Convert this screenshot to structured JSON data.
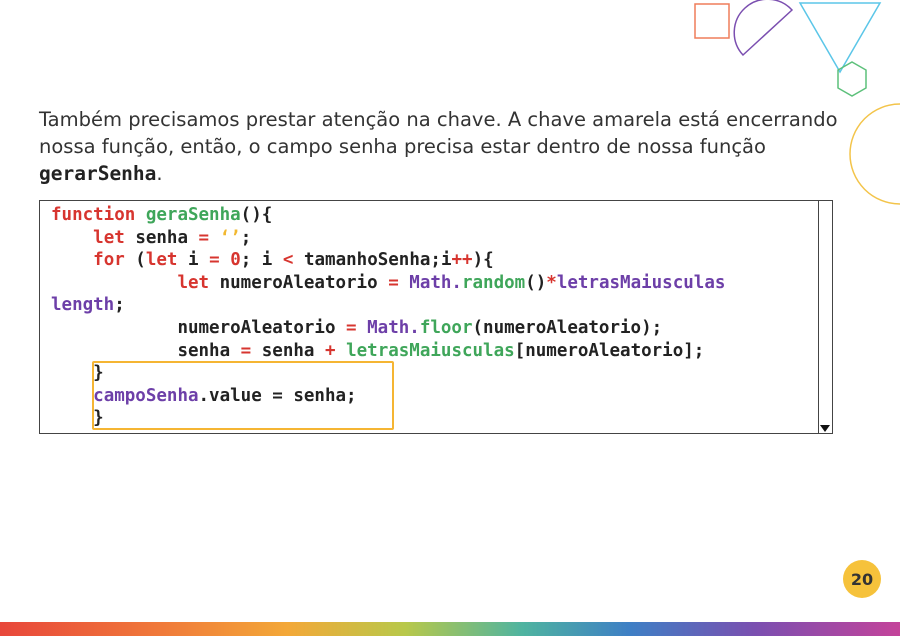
{
  "paragraph": {
    "text_before": "Também precisamos prestar atenção na chave. A chave amarela está encerrando nossa função, então, o campo senha precisa estar dentro de nossa função ",
    "code_term": "gerarSenha",
    "text_after": "."
  },
  "code": {
    "line1_kw": "function",
    "line1_fn": "geraSenha",
    "line1_rest": "(){",
    "line2_kw": "let",
    "line2_var": "senha",
    "line2_op": "=",
    "line2_str": "‘’",
    "line2_end": ";",
    "line3_for": "for",
    "line3_let": "let",
    "line3_i": "i",
    "line3_eq": "=",
    "line3_zero": "0",
    "line3_mid": "; i",
    "line3_lt": "<",
    "line3_tam": "tamanhoSenha;i",
    "line3_inc": "++",
    "line3_end": "){",
    "line4_kw": "let",
    "line4_var": "numeroAleatorio",
    "line4_eq": "=",
    "line4_math": "Math.",
    "line4_random": "random",
    "line4_paren": "()",
    "line4_star": "*",
    "line4_letras": "letrasMaiusculas",
    "line5_length": "length",
    "line5_end": ";",
    "line6_var": "numeroAleatorio",
    "line6_eq": "=",
    "line6_math": "Math.",
    "line6_floor": "floor",
    "line6_rest": "(numeroAleatorio);",
    "line7_senha": "senha",
    "line7_eq": "=",
    "line7_senha2": "senha",
    "line7_plus": "+",
    "line7_letras": "letrasMaiusculas",
    "line7_rest": "[numeroAleatorio];",
    "line8_brace": "}",
    "line9_campo": "campoSenha",
    "line9_rest": ".value = senha;",
    "line10_brace": "}"
  },
  "page_number": "20",
  "colors": {
    "keyword": "#d7352f",
    "function": "#3fa65a",
    "variable": "#6d3fa8",
    "string": "#f2b830",
    "highlight_border": "#f5b533",
    "badge": "#f6c23b"
  }
}
